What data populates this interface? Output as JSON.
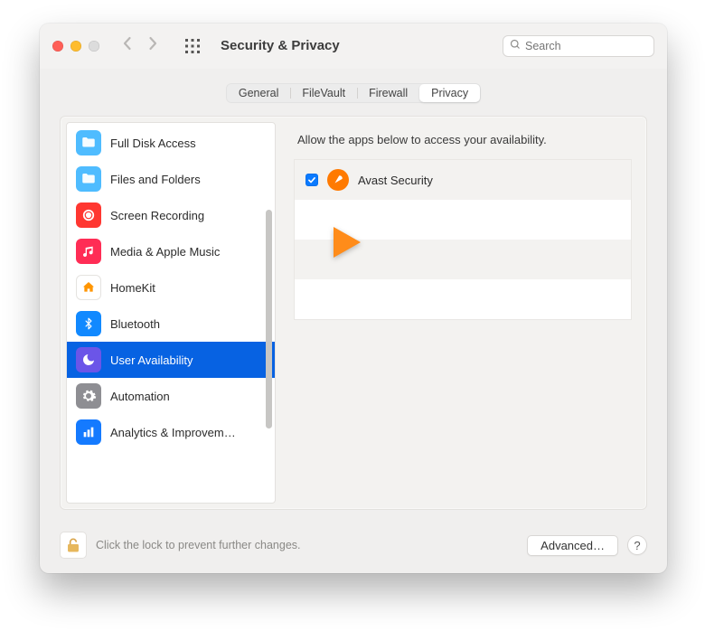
{
  "window": {
    "title": "Security & Privacy",
    "search_placeholder": "Search"
  },
  "tabs": [
    {
      "label": "General"
    },
    {
      "label": "FileVault"
    },
    {
      "label": "Firewall"
    },
    {
      "label": "Privacy",
      "active": true
    }
  ],
  "sidebar": {
    "items": [
      {
        "label": "Full Disk Access",
        "icon": "folder-icon",
        "bg": "#4fbcff"
      },
      {
        "label": "Files and Folders",
        "icon": "folder-icon",
        "bg": "#4fbcff"
      },
      {
        "label": "Screen Recording",
        "icon": "record-icon",
        "bg": "#ff3731"
      },
      {
        "label": "Media & Apple Music",
        "icon": "music-icon",
        "bg": "#ff2d55"
      },
      {
        "label": "HomeKit",
        "icon": "home-icon",
        "bg": "#ffffff"
      },
      {
        "label": "Bluetooth",
        "icon": "bluetooth-icon",
        "bg": "#1189ff"
      },
      {
        "label": "User Availability",
        "icon": "moon-icon",
        "bg": "#6b55e8",
        "selected": true
      },
      {
        "label": "Automation",
        "icon": "gear-icon",
        "bg": "#8e8e93"
      },
      {
        "label": "Analytics & Improvem…",
        "icon": "chart-icon",
        "bg": "#147aff"
      }
    ]
  },
  "detail": {
    "description": "Allow the apps below to access your availability.",
    "apps": [
      {
        "name": "Avast Security",
        "checked": true
      }
    ]
  },
  "footer": {
    "lock_text": "Click the lock to prevent further changes.",
    "advanced_label": "Advanced…",
    "help_label": "?"
  }
}
